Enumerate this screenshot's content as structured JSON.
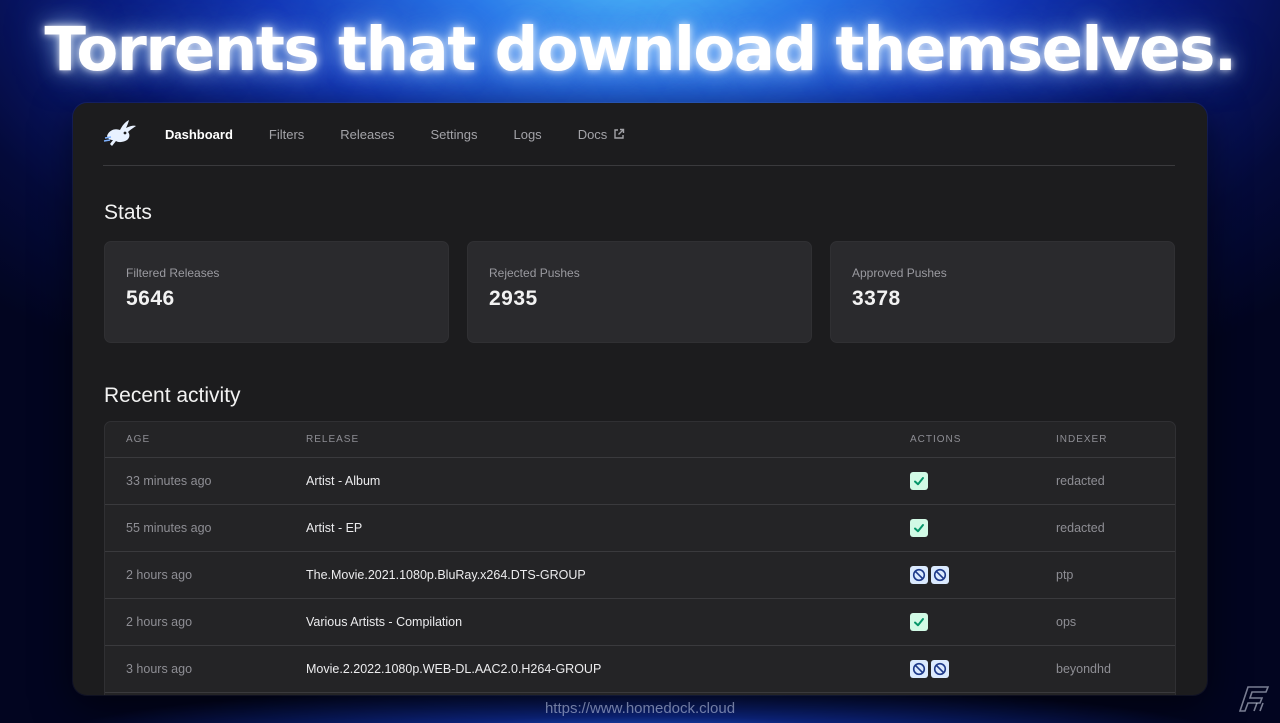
{
  "headline": "Torrents that download themselves.",
  "nav": {
    "items": [
      {
        "label": "Dashboard",
        "active": true
      },
      {
        "label": "Filters"
      },
      {
        "label": "Releases"
      },
      {
        "label": "Settings"
      },
      {
        "label": "Logs"
      },
      {
        "label": "Docs",
        "icon": "external-link-icon"
      }
    ]
  },
  "stats": {
    "title": "Stats",
    "cards": [
      {
        "label": "Filtered Releases",
        "value": "5646"
      },
      {
        "label": "Rejected Pushes",
        "value": "2935"
      },
      {
        "label": "Approved Pushes",
        "value": "3378"
      }
    ]
  },
  "recent": {
    "title": "Recent activity",
    "columns": [
      "AGE",
      "RELEASE",
      "ACTIONS",
      "INDEXER"
    ],
    "rows": [
      {
        "age": "33 minutes ago",
        "release": "Artist - Album",
        "actions": [
          "approved"
        ],
        "indexer": "redacted"
      },
      {
        "age": "55 minutes ago",
        "release": "Artist - EP",
        "actions": [
          "approved"
        ],
        "indexer": "redacted"
      },
      {
        "age": "2 hours ago",
        "release": "The.Movie.2021.1080p.BluRay.x264.DTS-GROUP",
        "actions": [
          "rejected",
          "rejected"
        ],
        "indexer": "ptp"
      },
      {
        "age": "2 hours ago",
        "release": "Various Artists - Compilation",
        "actions": [
          "approved"
        ],
        "indexer": "ops"
      },
      {
        "age": "3 hours ago",
        "release": "Movie.2.2022.1080p.WEB-DL.AAC2.0.H264-GROUP",
        "actions": [
          "rejected",
          "rejected"
        ],
        "indexer": "beyondhd"
      }
    ]
  },
  "watermark": "https://www.homedock.cloud",
  "colors": {
    "approved_bg": "#d1fae5",
    "approved_fg": "#059669",
    "rejected_bg": "#dbeafe",
    "rejected_fg": "#1e3a8a"
  }
}
